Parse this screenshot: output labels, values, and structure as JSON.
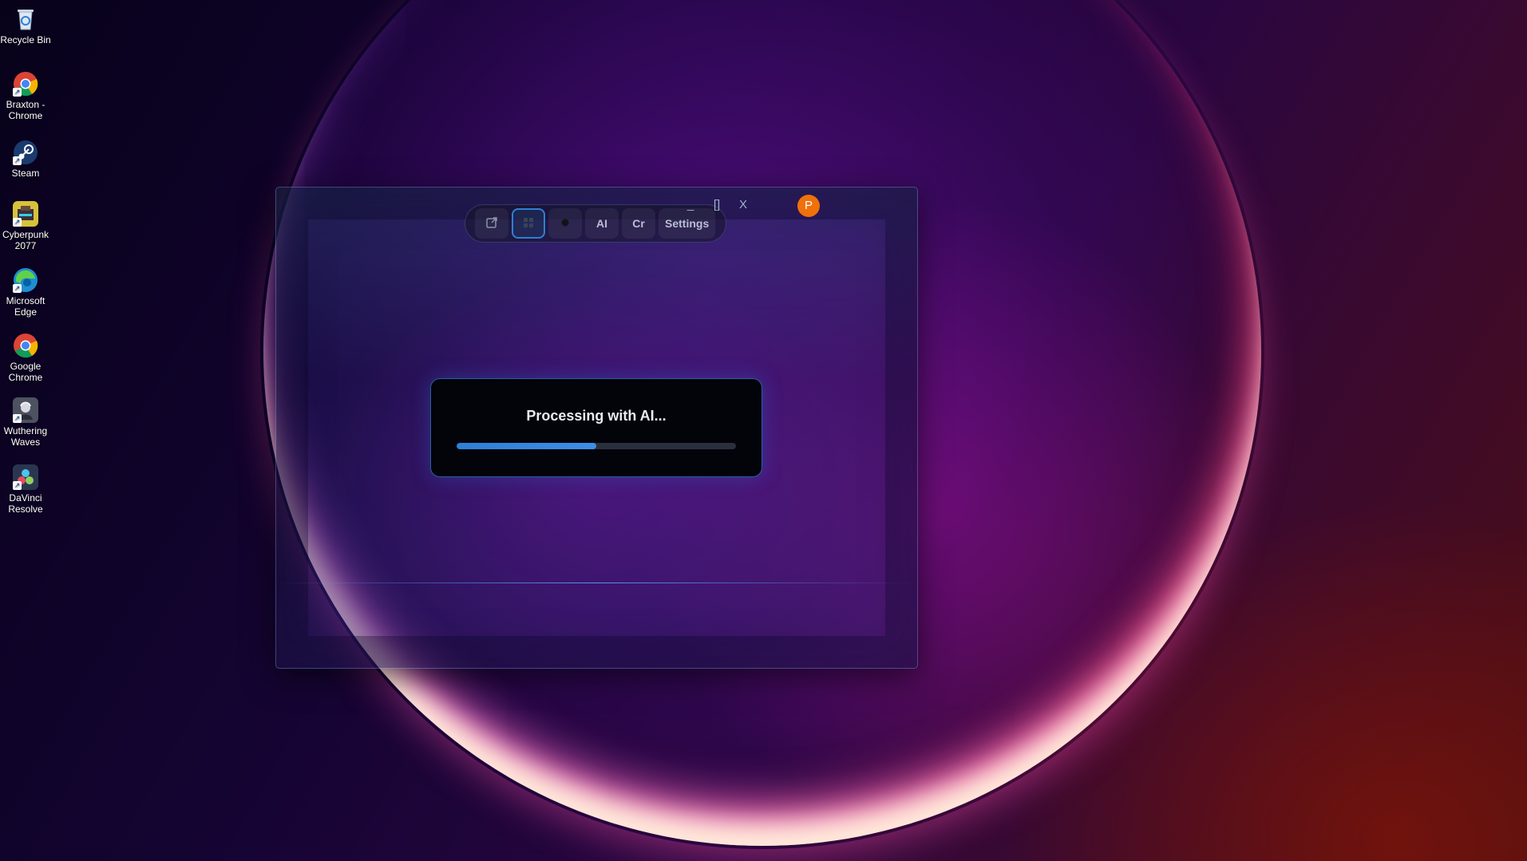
{
  "desktop": {
    "icons": [
      {
        "label": "Recycle Bin",
        "icon": "recycle-bin-icon",
        "color": "#3a7fd0",
        "shortcut": false
      },
      {
        "label": "Braxton - Chrome",
        "icon": "chrome-icon",
        "color": "#2c8d3c",
        "shortcut": true
      },
      {
        "label": "Steam",
        "icon": "steam-icon",
        "color": "#1a3f78",
        "shortcut": true
      },
      {
        "label": "Cyberpunk 2077",
        "icon": "cyberpunk-icon",
        "color": "#d8c23a",
        "shortcut": true
      },
      {
        "label": "Microsoft Edge",
        "icon": "edge-icon",
        "color": "#1fa6c9",
        "shortcut": true
      },
      {
        "label": "Google Chrome",
        "icon": "chrome-icon",
        "color": "#e0402f",
        "shortcut": true
      },
      {
        "label": "Wuthering Waves",
        "icon": "wuthering-waves-icon",
        "color": "#5a6070",
        "shortcut": true
      },
      {
        "label": "DaVinci Resolve",
        "icon": "davinci-resolve-icon",
        "color": "#3a4a6a",
        "shortcut": true
      }
    ]
  },
  "window": {
    "toolbar": {
      "buttons": [
        {
          "label": "",
          "icon": "capture-icon",
          "active": false
        },
        {
          "label": "",
          "icon": "grid-icon",
          "active": true
        },
        {
          "label": "",
          "icon": "record-dot-icon",
          "active": false
        },
        {
          "label": "AI",
          "icon": "",
          "active": false
        },
        {
          "label": "Cr",
          "icon": "",
          "active": false
        },
        {
          "label": "Settings",
          "icon": "",
          "active": false
        }
      ]
    },
    "avatar_initial": "P",
    "controls": {
      "minimize": "_",
      "maximize": "[]",
      "close": "X"
    },
    "modal": {
      "title": "Processing with AI...",
      "progress": 0.5
    }
  },
  "colors": {
    "accent": "#2e7fd4",
    "avatar": "#f0700a"
  }
}
